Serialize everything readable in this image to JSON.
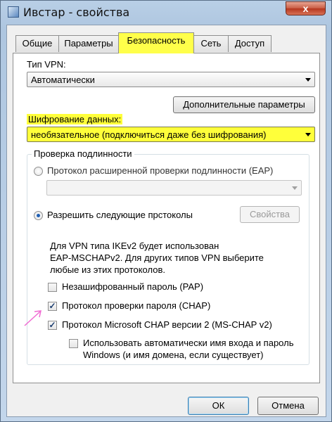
{
  "window": {
    "title": "Ивстар - свойства",
    "close_label": "x"
  },
  "tabs": [
    {
      "label": "Общие"
    },
    {
      "label": "Параметры"
    },
    {
      "label": "Безопасность"
    },
    {
      "label": "Сеть"
    },
    {
      "label": "Доступ"
    }
  ],
  "active_tab": "Безопасность",
  "vpn": {
    "label": "Тип VPN:",
    "value": "Автоматически",
    "advanced_button": "Дополнительные параметры"
  },
  "encryption": {
    "label": "Шифрование данных:",
    "value": "необязательное (подключиться даже без шифрования)"
  },
  "auth": {
    "group_title": "Проверка подлинности",
    "eap_radio": {
      "label": "Протокол расширенной проверки подлинности (EAP)",
      "selected": false
    },
    "eap_select_value": "",
    "allow_radio": {
      "label": "Разрешить следующие прстоколы",
      "selected": true
    },
    "properties_button": "Свойства",
    "info_line1": "Для VPN типа IKEv2 будет использован",
    "info_line2": "EAP-MSCHAPv2. Для других типов VPN выберите",
    "info_line3": "любые из этих протоколов.",
    "protocols": [
      {
        "label": "Незашифрованный пароль (PAP)",
        "checked": false
      },
      {
        "label": "Протокол проверки пароля (CHAP)",
        "checked": true
      },
      {
        "label": "Протокол Microsoft CHAP версии 2 (MS-CHAP v2)",
        "checked": true
      }
    ],
    "auto_login": {
      "line1": "Использовать автоматически имя входа и пароль",
      "line2": "Windows (и имя домена, если существует)",
      "checked": false
    }
  },
  "footer": {
    "ok": "ОК",
    "cancel": "Отмена"
  },
  "colors": {
    "highlight": "#ffff3a",
    "annotation_arrow": "#f06ad2"
  }
}
